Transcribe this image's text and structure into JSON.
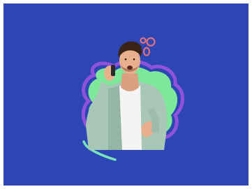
{
  "scene": {
    "description_free": true,
    "colors": {
      "background": "#2c46b6",
      "page_border": "#ffffff",
      "blob_green": "#7ee89a",
      "blob_purple": "#8f52d9",
      "accent_squiggle": "#79e3b8",
      "rings": "#e0707a",
      "shirt": "#a9c7b7",
      "tshirt": "#f4f4f4",
      "skin": "#e9b08e",
      "hair": "#3a2418",
      "phone": "#2a2a2a"
    },
    "icons": [
      "person-photo",
      "ring-decoration-icon",
      "squiggle-decoration-icon"
    ]
  }
}
